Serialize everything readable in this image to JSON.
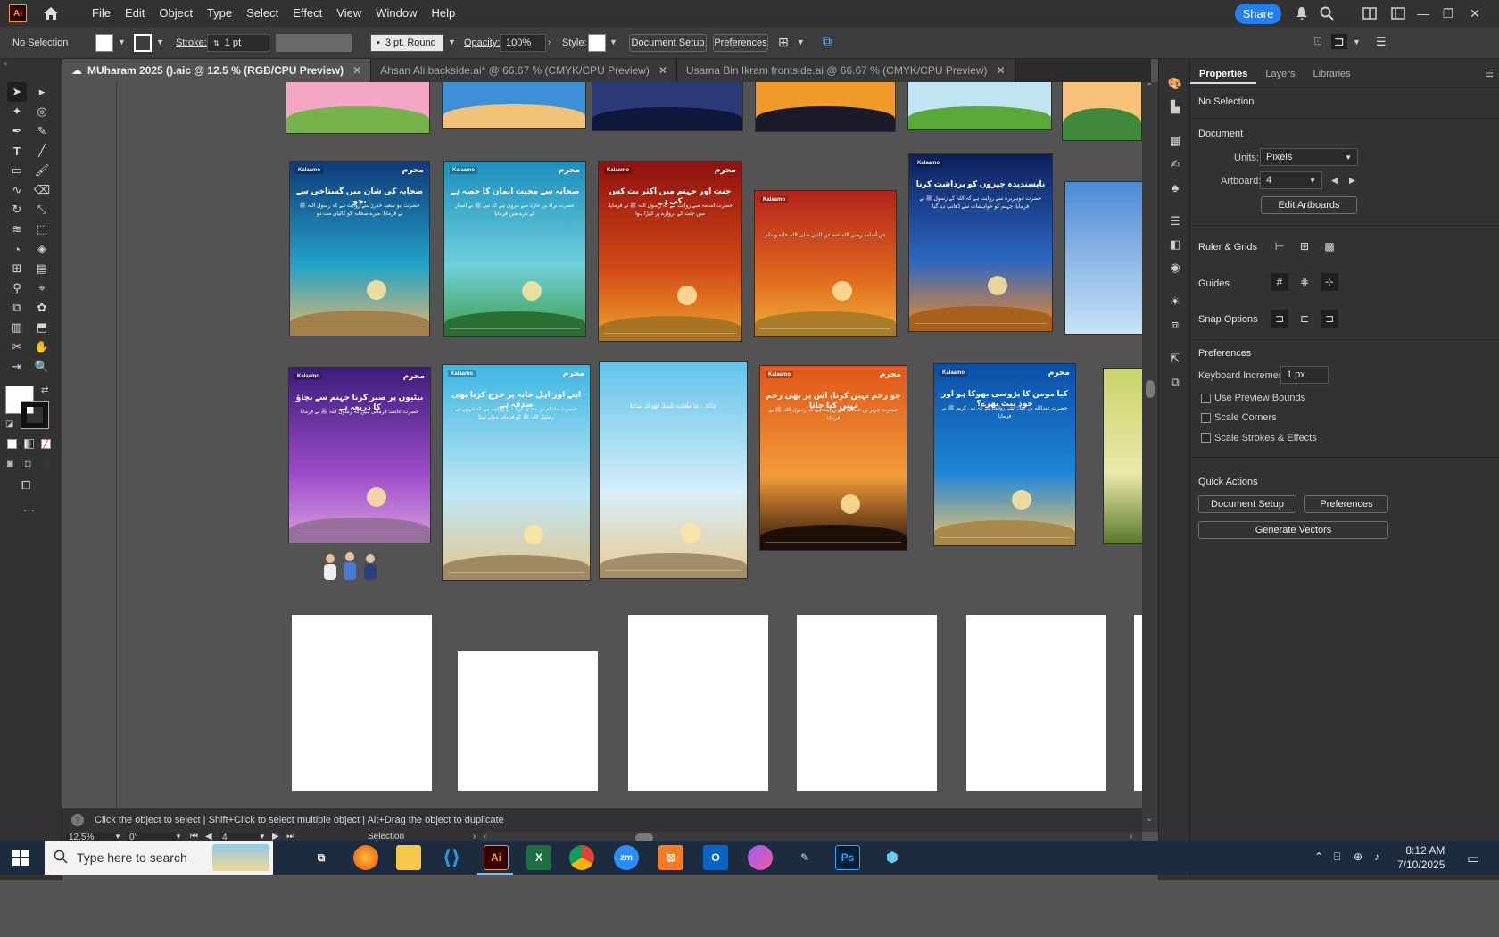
{
  "app": {
    "logo": "Ai",
    "name": "Adobe Illustrator"
  },
  "menu": [
    "File",
    "Edit",
    "Object",
    "Type",
    "Select",
    "Effect",
    "View",
    "Window",
    "Help"
  ],
  "topbar": {
    "share_label": "Share",
    "icons": [
      "bell-icon",
      "search-icon",
      "arrange-icon",
      "window-icon",
      "minimize-icon",
      "restore-icon",
      "close-icon"
    ]
  },
  "control": {
    "selection": "No Selection",
    "stroke_label": "Stroke:",
    "stroke_value": "1 pt",
    "brush_value": "3 pt. Round",
    "opacity_label": "Opacity:",
    "opacity_value": "100%",
    "style_label": "Style:",
    "doc_setup": "Document Setup",
    "preferences": "Preferences"
  },
  "tabs": [
    {
      "label": "MUharam 2025 ().aic @ 12.5 % (RGB/CPU Preview)",
      "active": true
    },
    {
      "label": "Ahsan Ali backside.ai* @ 66.67 % (CMYK/CPU Preview)",
      "active": false
    },
    {
      "label": "Usama Bin Ikram frontside.ai @ 66.67 % (CMYK/CPU Preview)",
      "active": false
    }
  ],
  "posters": [
    {
      "logo": "Kalaamo",
      "brand": "محرم",
      "title": "صحابہ کی شان میں گستاخی سے بچو",
      "body": "حضرت ابو سعید خدریؓ سے روایت ہے کہ رسول اللہ ﷺ نے فرمایا: میرے صحابہ کو گالیاں مت دو",
      "colors": [
        "#0f3a7a",
        "#22a3c7",
        "#e9b56b"
      ]
    },
    {
      "logo": "Kalaamo",
      "brand": "محرم",
      "title": "صحابہ سے محبت ایمان کا حصہ ہے",
      "body": "حضرت براء بن عازبؓ سے مروی ہے کہ نبی ﷺ نے انصار کے بارے میں فرمایا",
      "colors": [
        "#1b8fbf",
        "#6fd0d8",
        "#3f9f4b"
      ]
    },
    {
      "logo": "Kalaamo",
      "brand": "محرم",
      "title": "جنت اور جہنم میں اکثر یت کس کی ہے",
      "body": "حضرت اسامہ سے روایت ہے کہ رسول اللہ ﷺ نے فرمایا: میں جنت کے دروازے پر کھڑا ہوا",
      "colors": [
        "#8f1010",
        "#d24a14",
        "#f0a430"
      ]
    },
    {
      "logo": "Kalaamo",
      "brand": "",
      "title": "",
      "body": "عن أسامة رضي الله عنه عن النبي صلى الله عليه وسلم",
      "colors": [
        "#b3221b",
        "#e06a1e",
        "#f3b13a"
      ]
    },
    {
      "logo": "Kalaamo",
      "brand": "",
      "title": "ناپسندیدہ چیزوں کو برداشت کرنا",
      "body": "حضرت ابوہریرہ سے روایت ہے کہ اللہ کے رسول ﷺ نے فرمایا: جہنم کو خواہشات سے ڈھانپ دیا گیا",
      "colors": [
        "#0b1f5c",
        "#2c67c1",
        "#f08a2a"
      ]
    },
    {
      "logo": "Kalaamo",
      "brand": "محرم",
      "title": "بیٹیوں پر صبر کرنا جہنم سے بچاؤ کا ذریعہ ہے",
      "body": "حضرت عائشہؓ فرماتی ہیں کہ رسول اللہ ﷺ نے فرمایا",
      "colors": [
        "#3b1d7a",
        "#9b4bc8",
        "#d99fe0"
      ]
    },
    {
      "logo": "Kalaamo",
      "brand": "محرم",
      "title": "اپنے اور اہل خانہ پر خرچ کرنا بھی صدقہ ہے",
      "body": "حضرت مقدام بن معدی کربؓ سے روایت ہے کہ انہوں نے رسول اللہ ﷺ کو فرماتے ہوئے سنا",
      "colors": [
        "#3db6e2",
        "#bfe8f4",
        "#e4c58f"
      ]
    },
    {
      "logo": "",
      "brand": "",
      "title": "",
      "body": "حَدَّثَنَا ... مَا أَطْعَمْتَ نَفْسَكَ فَهُوَ لَكَ صَدَقَةٌ",
      "colors": [
        "#62c4ea",
        "#d7eef6",
        "#e8cc96"
      ]
    },
    {
      "logo": "Kalaamo",
      "brand": "محرم",
      "title": "جو رحم نہیں کرتا، اس پر بھی رحم نہیں کیا جاتا",
      "body": "حضرت جریر بن عبداللہؓ سے روایت ہے کہ رسول اللہ ﷺ نے فرمایا",
      "colors": [
        "#e0561a",
        "#f29b3a",
        "#2a1408"
      ]
    },
    {
      "logo": "Kalaamo",
      "brand": "محرم",
      "title": "کیا مومن کا پڑوسی بھوکا ہو اور خود پیٹ بھرے؟",
      "body": "حضرت عبداللہ بن عباسؓ سے روایت ہے کہ نبی کریم ﷺ نے فرمایا",
      "colors": [
        "#0b4ea6",
        "#1e86d6",
        "#f3c46a"
      ]
    }
  ],
  "top_row_colors": [
    [
      "#f4a6c5",
      "#76b34a"
    ],
    [
      "#3d8fd6",
      "#f0c27a"
    ],
    [
      "#2a3a78",
      "#0f173d"
    ],
    [
      "#f09a2a",
      "#1a1a2a"
    ],
    [
      "#bfe4f2",
      "#5aa83a"
    ],
    [
      "#f7c27a",
      "#3e8a3a"
    ]
  ],
  "status": {
    "hint": "Click the object to select  |  Shift+Click to select multiple object  |  Alt+Drag the object to duplicate",
    "zoom": "12.5%",
    "rotation": "0°",
    "artboard_num": "4",
    "tool": "Selection"
  },
  "properties": {
    "tabs": [
      "Properties",
      "Layers",
      "Libraries"
    ],
    "selection": "No Selection",
    "document_title": "Document",
    "units_label": "Units:",
    "units_value": "Pixels",
    "artboard_label": "Artboard:",
    "artboard_value": "4",
    "edit_artboards": "Edit Artboards",
    "rulers_grids": "Ruler & Grids",
    "guides": "Guides",
    "snap_options": "Snap Options",
    "preferences_title": "Preferences",
    "keyboard_increment_label": "Keyboard Increment:",
    "keyboard_increment_value": "1 px",
    "checkboxes": [
      "Use Preview Bounds",
      "Scale Corners",
      "Scale Strokes & Effects"
    ],
    "quick_actions": "Quick Actions",
    "btn_doc_setup": "Document Setup",
    "btn_preferences": "Preferences",
    "btn_generate": "Generate Vectors"
  },
  "taskbar": {
    "search_placeholder": "Type here to search",
    "apps": [
      "task-view",
      "firefox",
      "file-explorer",
      "vscode",
      "illustrator",
      "excel",
      "chrome",
      "zoom",
      "xampp",
      "outlook",
      "canva",
      "paint",
      "photoshop",
      "app"
    ],
    "time": "8:12 AM",
    "date": "7/10/2025"
  }
}
